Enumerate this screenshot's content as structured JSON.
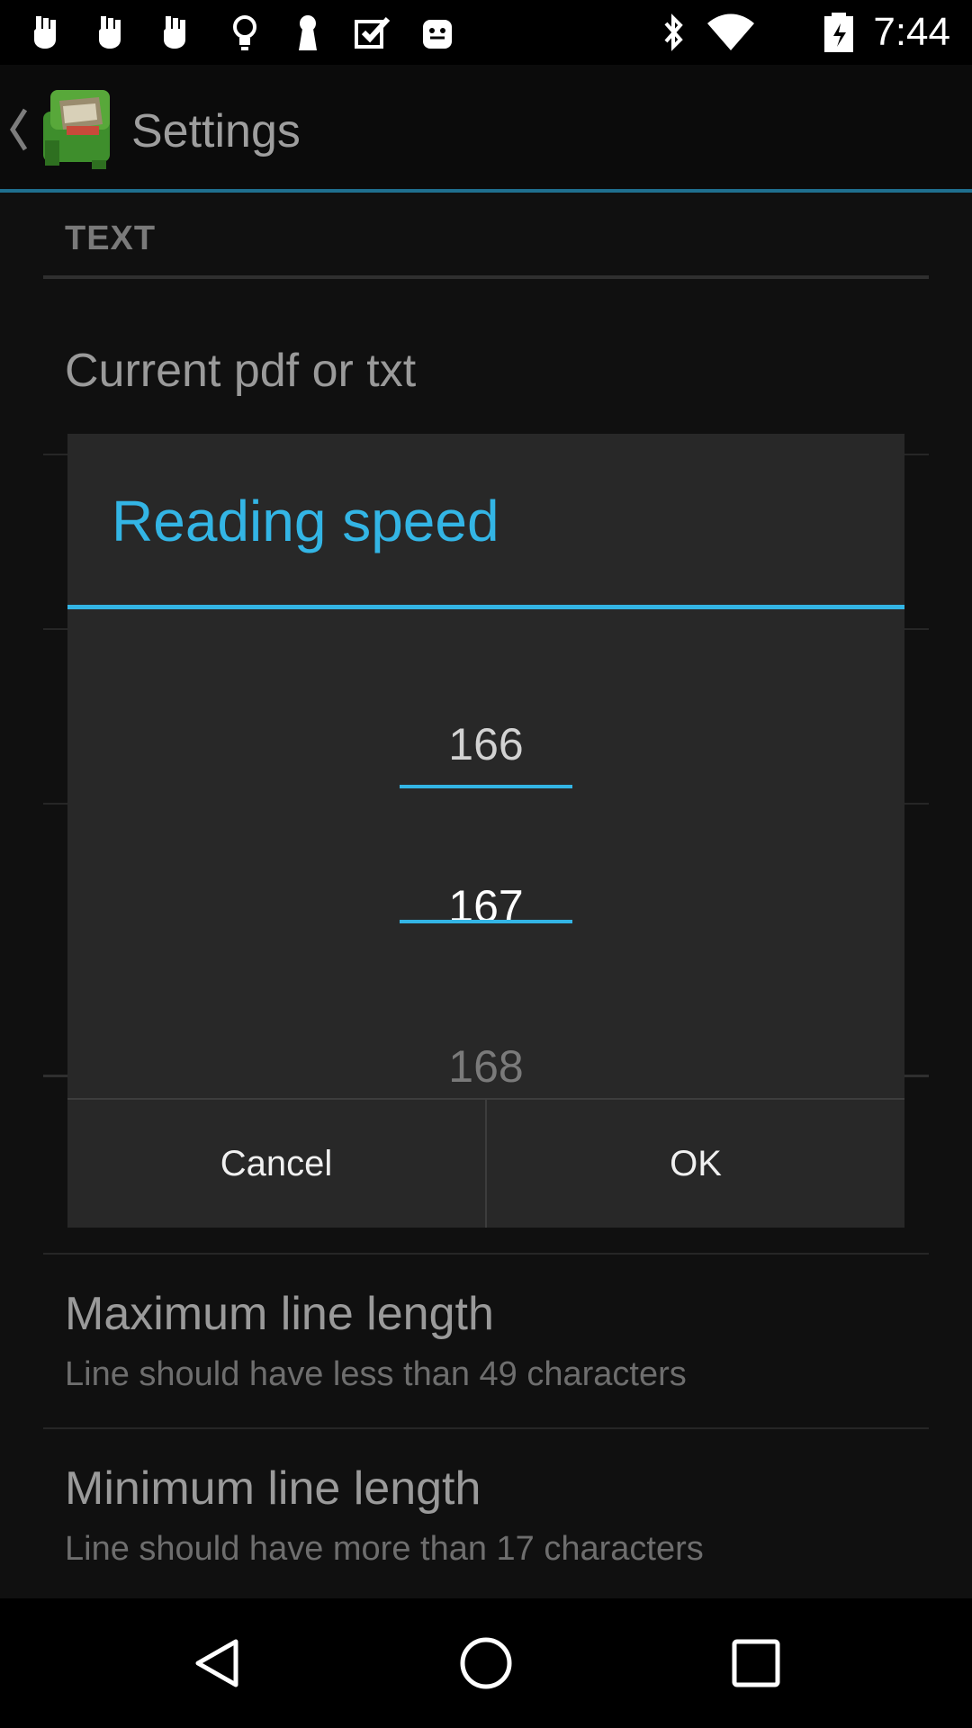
{
  "status_bar": {
    "time": "7:44",
    "left_icons": [
      "notification-icon",
      "notification-icon",
      "notification-icon",
      "lightbulb-icon",
      "keyhole-icon",
      "checkbox-icon",
      "android-icon"
    ],
    "right_icons": [
      "bluetooth-icon",
      "wifi-icon",
      "battery-icon"
    ]
  },
  "action_bar": {
    "title": "Settings"
  },
  "settings": {
    "section_header": "TEXT",
    "items": [
      {
        "title": "Current pdf or txt",
        "summary": ""
      },
      {
        "title": "Maximum line length",
        "summary": "Line should have less than 49 characters"
      },
      {
        "title": "Minimum line length",
        "summary": "Line should have more than 17 characters"
      }
    ]
  },
  "dialog": {
    "title": "Reading speed",
    "picker": {
      "previous": "166",
      "current": "167",
      "next": "168"
    },
    "cancel_label": "Cancel",
    "ok_label": "OK"
  },
  "colors": {
    "accent": "#33b5e5",
    "dialog_bg": "#282828",
    "background": "#101010"
  },
  "nav_bar": {
    "icons": [
      "back-icon",
      "home-icon",
      "recents-icon"
    ]
  }
}
